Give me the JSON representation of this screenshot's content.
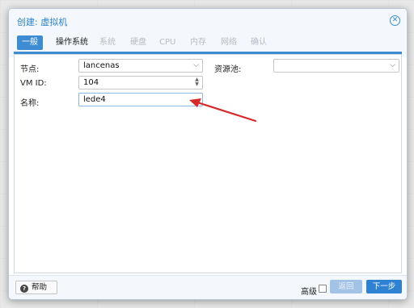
{
  "dialog": {
    "title": "创建: 虚拟机",
    "close_icon": "close-circle-icon"
  },
  "tabs": [
    {
      "label": "一般",
      "state": "active"
    },
    {
      "label": "操作系统",
      "state": "enabled"
    },
    {
      "label": "系统",
      "state": "disabled"
    },
    {
      "label": "硬盘",
      "state": "disabled"
    },
    {
      "label": "CPU",
      "state": "disabled"
    },
    {
      "label": "内存",
      "state": "disabled"
    },
    {
      "label": "网络",
      "state": "disabled"
    },
    {
      "label": "确认",
      "state": "disabled"
    }
  ],
  "form": {
    "node_label": "节点:",
    "node_value": "lancenas",
    "vmid_label": "VM ID:",
    "vmid_value": "104",
    "name_label": "名称:",
    "name_value": "lede4",
    "pool_label": "资源池:",
    "pool_value": ""
  },
  "footer": {
    "help_label": "帮助",
    "advanced_label": "高级",
    "advanced_checked": false,
    "back_label": "返回",
    "next_label": "下一步"
  },
  "colors": {
    "accent": "#3d8cd3",
    "annotation_arrow": "#d62a2a"
  }
}
